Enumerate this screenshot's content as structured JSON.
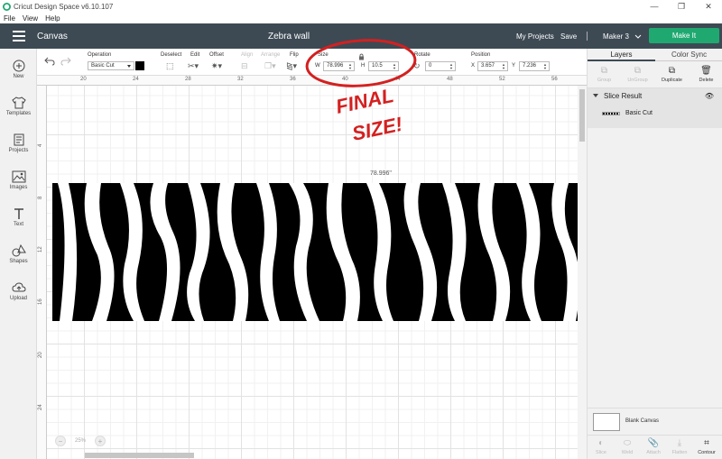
{
  "window": {
    "title": "Cricut Design Space  v6.10.107",
    "controls": [
      "—",
      "❐",
      "✕"
    ]
  },
  "menu": [
    "File",
    "View",
    "Help"
  ],
  "header": {
    "section": "Canvas",
    "doc_title": "Zebra wall",
    "my_projects": "My Projects",
    "save": "Save",
    "machine": "Maker 3",
    "make_it": "Make It"
  },
  "left_tools": [
    {
      "label": "New"
    },
    {
      "label": "Templates"
    },
    {
      "label": "Projects"
    },
    {
      "label": "Images"
    },
    {
      "label": "Text"
    },
    {
      "label": "Shapes"
    },
    {
      "label": "Upload"
    }
  ],
  "edit_toolbar": {
    "operation_label": "Operation",
    "operation_value": "Basic Cut",
    "deselect": "Deselect",
    "edit": "Edit",
    "offset": "Offset",
    "align": "Align",
    "arrange": "Arrange",
    "flip": "Flip",
    "size_label": "Size",
    "w_label": "W",
    "w_value": "78.996",
    "h_label": "H",
    "h_value": "10.5",
    "rotate_label": "Rotate",
    "rotate_value": "0",
    "position_label": "Position",
    "x_label": "X",
    "x_value": "3.657",
    "y_label": "Y",
    "y_value": "7.236"
  },
  "rulers": {
    "horizontal": [
      "20",
      "24",
      "28",
      "32",
      "36",
      "40",
      "44",
      "48",
      "52",
      "56"
    ],
    "vertical": [
      "4",
      "8",
      "12",
      "16",
      "20",
      "24"
    ]
  },
  "canvas": {
    "width_dimension": "78.996\"",
    "zoom": "25%",
    "zoom_out": "−",
    "zoom_in": "+"
  },
  "annotation": {
    "text_line1": "FINAL",
    "text_line2": "SIZE!",
    "color": "#d42020"
  },
  "right_panel": {
    "tabs": [
      "Layers",
      "Color Sync"
    ],
    "layer_tools": [
      "Group",
      "UnGroup",
      "Duplicate",
      "Delete"
    ],
    "group_name": "Slice Result",
    "layer_name": "Basic Cut",
    "blank_canvas": "Blank Canvas",
    "bottom_tools": [
      "Slice",
      "Weld",
      "Attach",
      "Flatten",
      "Contour"
    ]
  },
  "colors": {
    "header_bg": "#3d4a54",
    "make_it": "#1fa971",
    "annotation": "#d42020"
  }
}
